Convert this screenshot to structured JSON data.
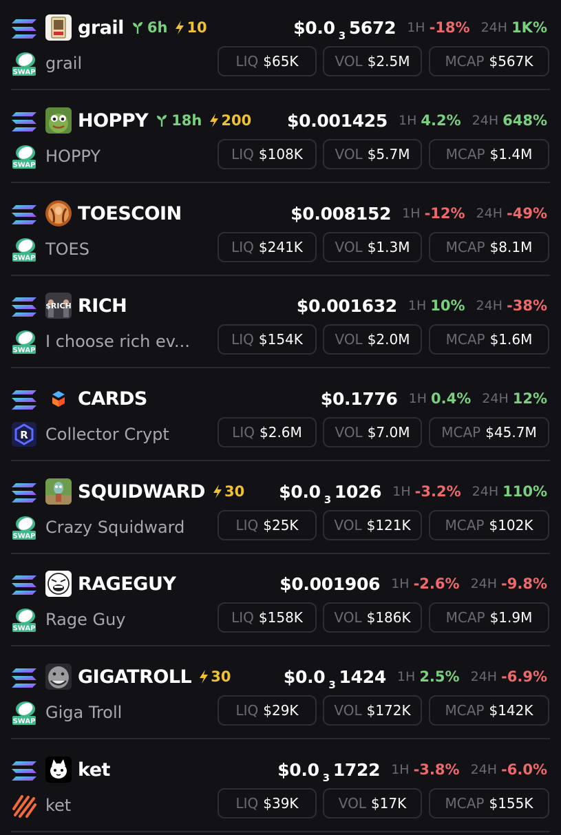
{
  "colors": {
    "background": "#121116",
    "positive": "#7ad07f",
    "negative": "#ee6a6a",
    "boost": "#f0c232",
    "label_gray": "#6b6a73"
  },
  "labels": {
    "h1": "1H",
    "h24": "24H",
    "liq": "LIQ",
    "vol": "VOL",
    "mcap": "MCAP"
  },
  "tokens": [
    {
      "symbol": "grail",
      "name": "grail",
      "age": "6h",
      "boost": "10",
      "price_prefix": "$0.0",
      "price_sub": "3",
      "price_rest": "5672",
      "change_1h": "-18%",
      "change_24h": "1K%",
      "liq": "$65K",
      "vol": "$2.5M",
      "mcap": "$567K",
      "chain_icon": "solana-icon",
      "dex_icon": "swap-icon",
      "avatar_icon": "card-avatar-icon"
    },
    {
      "symbol": "HOPPY",
      "name": "HOPPY",
      "age": "18h",
      "boost": "200",
      "price_prefix": "$0.001425",
      "price_sub": "",
      "price_rest": "",
      "change_1h": "4.2%",
      "change_24h": "648%",
      "liq": "$108K",
      "vol": "$5.7M",
      "mcap": "$1.4M",
      "chain_icon": "solana-icon",
      "dex_icon": "swap-icon",
      "avatar_icon": "frog-avatar-icon"
    },
    {
      "symbol": "TOESCOIN",
      "name": "TOES",
      "age": "",
      "boost": "",
      "price_prefix": "$0.008152",
      "price_sub": "",
      "price_rest": "",
      "change_1h": "-12%",
      "change_24h": "-49%",
      "liq": "$241K",
      "vol": "$1.3M",
      "mcap": "$8.1M",
      "chain_icon": "solana-icon",
      "dex_icon": "swap-icon",
      "avatar_icon": "toes-avatar-icon"
    },
    {
      "symbol": "RICH",
      "name": "I choose rich ev...",
      "age": "",
      "boost": "",
      "price_prefix": "$0.001632",
      "price_sub": "",
      "price_rest": "",
      "change_1h": "10%",
      "change_24h": "-38%",
      "liq": "$154K",
      "vol": "$2.0M",
      "mcap": "$1.6M",
      "chain_icon": "solana-icon",
      "dex_icon": "swap-icon",
      "avatar_icon": "rich-avatar-icon",
      "avatar_text": "$RICH"
    },
    {
      "symbol": "CARDS",
      "name": "Collector Crypt",
      "age": "",
      "boost": "",
      "price_prefix": "$0.1776",
      "price_sub": "",
      "price_rest": "",
      "change_1h": "0.4%",
      "change_24h": "12%",
      "liq": "$2.6M",
      "vol": "$7.0M",
      "mcap": "$45.7M",
      "chain_icon": "solana-icon",
      "dex_icon": "collector-crypt-icon",
      "avatar_icon": "cards-logo-icon"
    },
    {
      "symbol": "SQUIDWARD",
      "name": "Crazy Squidward",
      "age": "",
      "boost": "30",
      "price_prefix": "$0.0",
      "price_sub": "3",
      "price_rest": "1026",
      "change_1h": "-3.2%",
      "change_24h": "110%",
      "liq": "$25K",
      "vol": "$121K",
      "mcap": "$102K",
      "chain_icon": "solana-icon",
      "dex_icon": "swap-icon",
      "avatar_icon": "squidward-avatar-icon"
    },
    {
      "symbol": "RAGEGUY",
      "name": "Rage Guy",
      "age": "",
      "boost": "",
      "price_prefix": "$0.001906",
      "price_sub": "",
      "price_rest": "",
      "change_1h": "-2.6%",
      "change_24h": "-9.8%",
      "liq": "$158K",
      "vol": "$186K",
      "mcap": "$1.9M",
      "chain_icon": "solana-icon",
      "dex_icon": "swap-icon",
      "avatar_icon": "rageguy-avatar-icon"
    },
    {
      "symbol": "GIGATROLL",
      "name": "Giga Troll",
      "age": "",
      "boost": "30",
      "price_prefix": "$0.0",
      "price_sub": "3",
      "price_rest": "1424",
      "change_1h": "2.5%",
      "change_24h": "-6.9%",
      "liq": "$29K",
      "vol": "$172K",
      "mcap": "$142K",
      "chain_icon": "solana-icon",
      "dex_icon": "swap-icon",
      "avatar_icon": "troll-avatar-icon"
    },
    {
      "symbol": "ket",
      "name": "ket",
      "age": "",
      "boost": "",
      "price_prefix": "$0.0",
      "price_sub": "3",
      "price_rest": "1722",
      "change_1h": "-3.8%",
      "change_24h": "-6.0%",
      "liq": "$39K",
      "vol": "$17K",
      "mcap": "$155K",
      "chain_icon": "solana-icon",
      "dex_icon": "pumpfun-icon",
      "avatar_icon": "cat-avatar-icon"
    }
  ]
}
